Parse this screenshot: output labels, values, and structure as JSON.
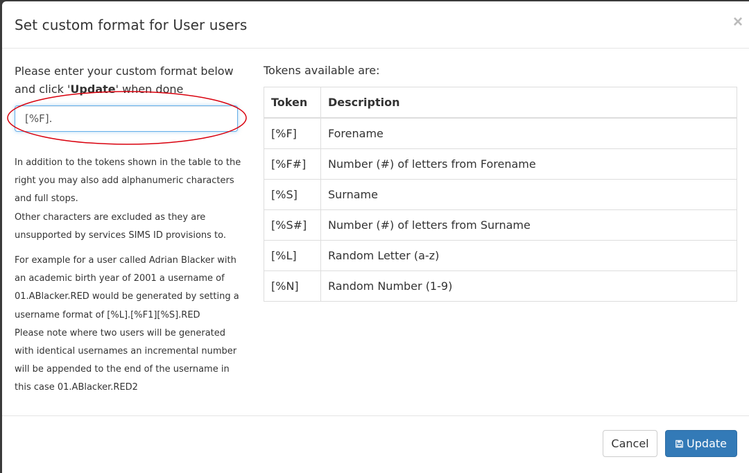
{
  "modal": {
    "title": "Set custom format for User users",
    "close_label": "×"
  },
  "left": {
    "intro_prefix": "Please enter your custom format below and click '",
    "intro_bold": "Update",
    "intro_suffix": "' when done",
    "input_value": "[%F].",
    "help": [
      "In addition to the tokens shown in the table to the right you may also add alphanumeric characters and full stops.",
      "Other characters are excluded as they are unsupported by services SIMS ID provisions to.",
      "For example for a user called Adrian Blacker with an academic birth year of 2001 a username of 01.ABlacker.RED would be generated by setting a username format of [%L].[%F1][%S].RED",
      "Please note where two users will be generated with identical usernames an incremental number will be appended to the end of the username in this case 01.ABlacker.RED2"
    ]
  },
  "right": {
    "tokens_label": "Tokens available are:",
    "columns": [
      "Token",
      "Description"
    ],
    "rows": [
      {
        "token": "[%F]",
        "description": "Forename"
      },
      {
        "token": "[%F#]",
        "description": "Number (#) of letters from Forename"
      },
      {
        "token": "[%S]",
        "description": "Surname"
      },
      {
        "token": "[%S#]",
        "description": "Number (#) of letters from Surname"
      },
      {
        "token": "[%L]",
        "description": "Random Letter (a-z)"
      },
      {
        "token": "[%N]",
        "description": "Random Number (1-9)"
      }
    ]
  },
  "footer": {
    "cancel_label": "Cancel",
    "update_label": "Update"
  },
  "colors": {
    "primary": "#337ab7",
    "annotation_red": "#d9000d",
    "focus_border": "#66afe9"
  },
  "icons": {
    "close": "close-icon",
    "save": "floppy-disk-icon"
  }
}
